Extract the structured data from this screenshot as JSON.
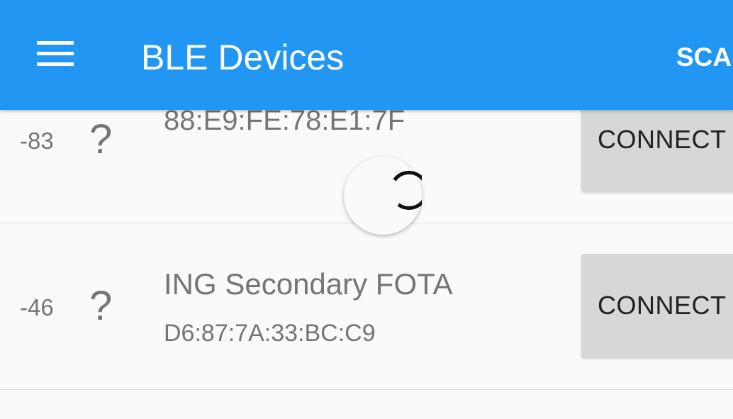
{
  "appbar": {
    "title": "BLE Devices",
    "scan_label": "SCAN",
    "menu_icon": "hamburger-menu-icon",
    "color": "#2196f3"
  },
  "devices": [
    {
      "rssi": "-83",
      "icon": "?",
      "name": "",
      "address": "88:E9:FE:78:E1:7F",
      "connect_label": "CONNECT"
    },
    {
      "rssi": "-46",
      "icon": "?",
      "name": "ING Secondary FOTA",
      "address": "D6:87:7A:33:BC:C9",
      "connect_label": "CONNECT"
    }
  ],
  "refresh_indicator": "loading-spinner-icon"
}
